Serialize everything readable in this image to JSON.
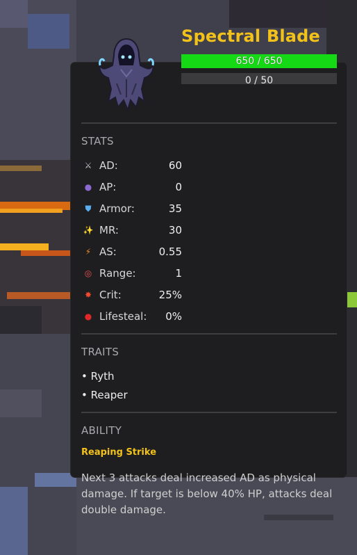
{
  "unit": {
    "name": "Spectral Blade",
    "hp_text": "650 / 650",
    "hp_fraction": 1.0,
    "mana_text": "0 / 50",
    "mana_fraction": 0.0
  },
  "stats": {
    "title": "STATS",
    "rows": [
      {
        "icon": "sword-icon",
        "glyph": "⚔",
        "label": "AD:",
        "value": "60"
      },
      {
        "icon": "orb-icon",
        "glyph": "●",
        "label": "AP:",
        "value": "0"
      },
      {
        "icon": "shield-icon",
        "glyph": "⛊",
        "label": "Armor:",
        "value": "35"
      },
      {
        "icon": "sparkles-icon",
        "glyph": "✨",
        "label": "MR:",
        "value": "30"
      },
      {
        "icon": "lightning-icon",
        "glyph": "⚡",
        "label": "AS:",
        "value": "0.55"
      },
      {
        "icon": "target-icon",
        "glyph": "◎",
        "label": "Range:",
        "value": "1"
      },
      {
        "icon": "burst-icon",
        "glyph": "✸",
        "label": "Crit:",
        "value": "25%"
      },
      {
        "icon": "blood-drop-icon",
        "glyph": "●",
        "label": "Lifesteal:",
        "value": "0%"
      }
    ]
  },
  "traits": {
    "title": "TRAITS",
    "items": [
      "• Ryth",
      "• Reaper"
    ]
  },
  "ability": {
    "title": "ABILITY",
    "name": "Reaping Strike",
    "description": "Next 3 attacks deal increased AD as physical damage. If target is below 40% HP, attacks deal double damage."
  },
  "colors": {
    "accent": "#f2c21b",
    "hp": "#15d915",
    "panel": "#1e1e20"
  }
}
